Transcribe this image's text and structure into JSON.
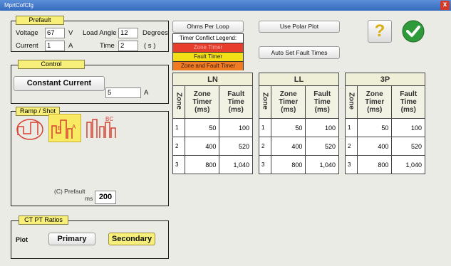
{
  "window": {
    "title": "MprtCofCfg",
    "close_label": "x"
  },
  "prefault": {
    "title": "Prefault",
    "voltage_label": "Voltage",
    "voltage_value": "67",
    "voltage_unit": "V",
    "load_angle_label": "Load Angle",
    "load_angle_value": "12",
    "load_angle_unit": "Degrees",
    "current_label": "Current",
    "current_value": "1",
    "current_unit": "A",
    "time_label": "Time",
    "time_value": "2",
    "time_unit": "( s )"
  },
  "control": {
    "title": "Control",
    "mode_button": "Constant Current",
    "value": "5",
    "unit": "A"
  },
  "ramp": {
    "title": "Ramp / Shot",
    "prefault_label": "(C) Prefault",
    "prefault_unit": "ms",
    "prefault_value": "200",
    "icon_labels": {
      "b": "B",
      "a": "A",
      "bc": "BC"
    }
  },
  "ctpt": {
    "title": "CT PT Ratios",
    "plot_label": "Plot",
    "primary_label": "Primary",
    "secondary_label": "Secondary"
  },
  "buttons": {
    "ohms_per_loop": "Ohms Per Loop",
    "use_polar_plot": "Use Polar Plot",
    "auto_set_fault_times": "Auto Set Fault Times",
    "help": "?"
  },
  "legend": {
    "title": "Timer Conflict Legend:",
    "items": [
      {
        "label": "Zone Timer",
        "color": "#e83c2c"
      },
      {
        "label": "Fault Timer",
        "color": "#f2df16"
      },
      {
        "label": "Zone and Fault Timer",
        "color": "#f07a22"
      }
    ]
  },
  "tables": [
    {
      "name": "LN",
      "zone_header": "Zone",
      "zone_timer_header": "Zone Timer (ms)",
      "fault_time_header": "Fault Time (ms)",
      "rows": [
        {
          "zone": "1",
          "zone_timer": "50",
          "fault_time": "100"
        },
        {
          "zone": "2",
          "zone_timer": "400",
          "fault_time": "520"
        },
        {
          "zone": "3",
          "zone_timer": "800",
          "fault_time": "1,040"
        }
      ]
    },
    {
      "name": "LL",
      "zone_header": "Zone",
      "zone_timer_header": "Zone Timer (ms)",
      "fault_time_header": "Fault Time (ms)",
      "rows": [
        {
          "zone": "1",
          "zone_timer": "50",
          "fault_time": "100"
        },
        {
          "zone": "2",
          "zone_timer": "400",
          "fault_time": "520"
        },
        {
          "zone": "3",
          "zone_timer": "800",
          "fault_time": "1,040"
        }
      ]
    },
    {
      "name": "3P",
      "zone_header": "Zone",
      "zone_timer_header": "Zone Timer (ms)",
      "fault_time_header": "Fault Time (ms)",
      "rows": [
        {
          "zone": "1",
          "zone_timer": "50",
          "fault_time": "100"
        },
        {
          "zone": "2",
          "zone_timer": "400",
          "fault_time": "520"
        },
        {
          "zone": "3",
          "zone_timer": "800",
          "fault_time": "1,040"
        }
      ]
    }
  ],
  "colors": {
    "group_title": "#f7ef7a",
    "secondary_active": "#f7ef7a",
    "ok_green": "#2e9a3a",
    "titlebar": "#4a7fcf"
  }
}
